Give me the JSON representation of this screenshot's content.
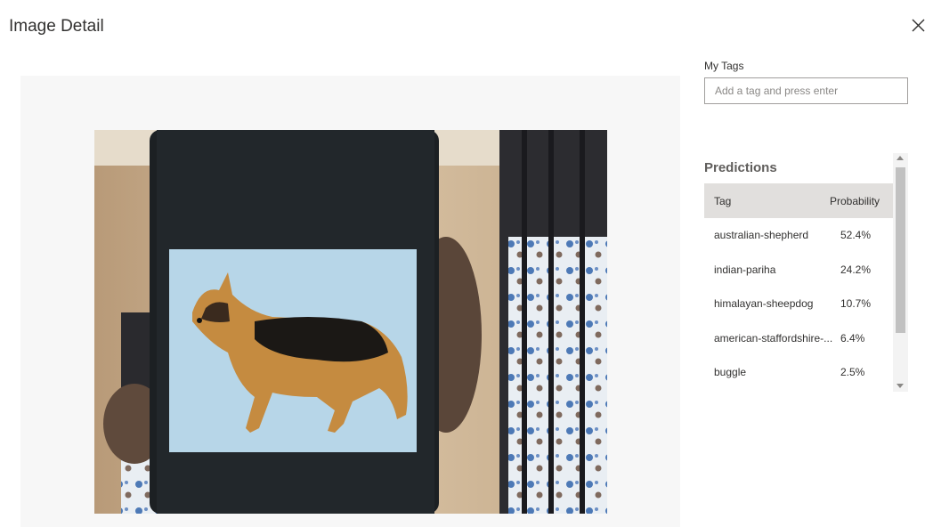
{
  "dialog": {
    "title": "Image Detail",
    "close_icon": "close-icon"
  },
  "tags": {
    "label": "My Tags",
    "placeholder": "Add a tag and press enter",
    "value": ""
  },
  "predictions": {
    "heading": "Predictions",
    "columns": {
      "tag": "Tag",
      "probability": "Probability"
    },
    "rows": [
      {
        "tag": "australian-shepherd",
        "probability": "52.4%"
      },
      {
        "tag": "indian-pariha",
        "probability": "24.2%"
      },
      {
        "tag": "himalayan-sheepdog",
        "probability": "10.7%"
      },
      {
        "tag": "american-staffordshire-...",
        "probability": "6.4%"
      },
      {
        "tag": "buggle",
        "probability": "2.5%"
      }
    ]
  },
  "colors": {
    "panel_bg": "#f7f7f7",
    "header_bg": "#e1dfdd",
    "text": "#323130"
  }
}
